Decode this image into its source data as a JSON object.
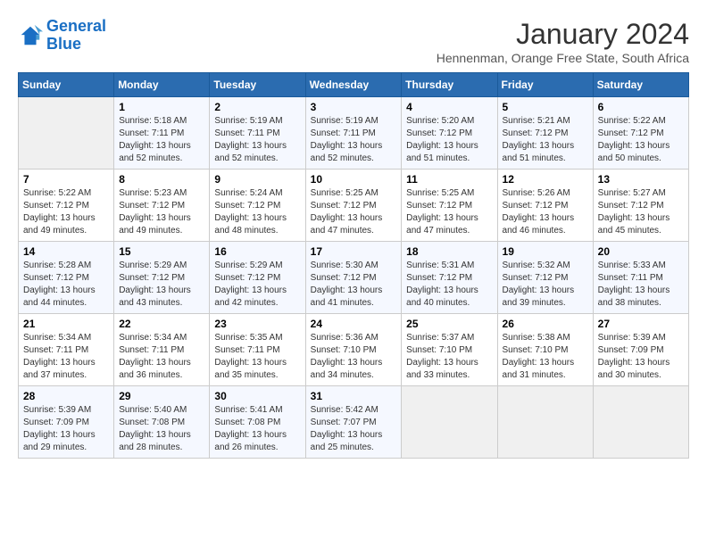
{
  "logo": {
    "line1": "General",
    "line2": "Blue"
  },
  "title": "January 2024",
  "location": "Hennenman, Orange Free State, South Africa",
  "weekdays": [
    "Sunday",
    "Monday",
    "Tuesday",
    "Wednesday",
    "Thursday",
    "Friday",
    "Saturday"
  ],
  "weeks": [
    [
      {
        "day": "",
        "sunrise": "",
        "sunset": "",
        "daylight": ""
      },
      {
        "day": "1",
        "sunrise": "Sunrise: 5:18 AM",
        "sunset": "Sunset: 7:11 PM",
        "daylight": "Daylight: 13 hours and 52 minutes."
      },
      {
        "day": "2",
        "sunrise": "Sunrise: 5:19 AM",
        "sunset": "Sunset: 7:11 PM",
        "daylight": "Daylight: 13 hours and 52 minutes."
      },
      {
        "day": "3",
        "sunrise": "Sunrise: 5:19 AM",
        "sunset": "Sunset: 7:11 PM",
        "daylight": "Daylight: 13 hours and 52 minutes."
      },
      {
        "day": "4",
        "sunrise": "Sunrise: 5:20 AM",
        "sunset": "Sunset: 7:12 PM",
        "daylight": "Daylight: 13 hours and 51 minutes."
      },
      {
        "day": "5",
        "sunrise": "Sunrise: 5:21 AM",
        "sunset": "Sunset: 7:12 PM",
        "daylight": "Daylight: 13 hours and 51 minutes."
      },
      {
        "day": "6",
        "sunrise": "Sunrise: 5:22 AM",
        "sunset": "Sunset: 7:12 PM",
        "daylight": "Daylight: 13 hours and 50 minutes."
      }
    ],
    [
      {
        "day": "7",
        "sunrise": "Sunrise: 5:22 AM",
        "sunset": "Sunset: 7:12 PM",
        "daylight": "Daylight: 13 hours and 49 minutes."
      },
      {
        "day": "8",
        "sunrise": "Sunrise: 5:23 AM",
        "sunset": "Sunset: 7:12 PM",
        "daylight": "Daylight: 13 hours and 49 minutes."
      },
      {
        "day": "9",
        "sunrise": "Sunrise: 5:24 AM",
        "sunset": "Sunset: 7:12 PM",
        "daylight": "Daylight: 13 hours and 48 minutes."
      },
      {
        "day": "10",
        "sunrise": "Sunrise: 5:25 AM",
        "sunset": "Sunset: 7:12 PM",
        "daylight": "Daylight: 13 hours and 47 minutes."
      },
      {
        "day": "11",
        "sunrise": "Sunrise: 5:25 AM",
        "sunset": "Sunset: 7:12 PM",
        "daylight": "Daylight: 13 hours and 47 minutes."
      },
      {
        "day": "12",
        "sunrise": "Sunrise: 5:26 AM",
        "sunset": "Sunset: 7:12 PM",
        "daylight": "Daylight: 13 hours and 46 minutes."
      },
      {
        "day": "13",
        "sunrise": "Sunrise: 5:27 AM",
        "sunset": "Sunset: 7:12 PM",
        "daylight": "Daylight: 13 hours and 45 minutes."
      }
    ],
    [
      {
        "day": "14",
        "sunrise": "Sunrise: 5:28 AM",
        "sunset": "Sunset: 7:12 PM",
        "daylight": "Daylight: 13 hours and 44 minutes."
      },
      {
        "day": "15",
        "sunrise": "Sunrise: 5:29 AM",
        "sunset": "Sunset: 7:12 PM",
        "daylight": "Daylight: 13 hours and 43 minutes."
      },
      {
        "day": "16",
        "sunrise": "Sunrise: 5:29 AM",
        "sunset": "Sunset: 7:12 PM",
        "daylight": "Daylight: 13 hours and 42 minutes."
      },
      {
        "day": "17",
        "sunrise": "Sunrise: 5:30 AM",
        "sunset": "Sunset: 7:12 PM",
        "daylight": "Daylight: 13 hours and 41 minutes."
      },
      {
        "day": "18",
        "sunrise": "Sunrise: 5:31 AM",
        "sunset": "Sunset: 7:12 PM",
        "daylight": "Daylight: 13 hours and 40 minutes."
      },
      {
        "day": "19",
        "sunrise": "Sunrise: 5:32 AM",
        "sunset": "Sunset: 7:12 PM",
        "daylight": "Daylight: 13 hours and 39 minutes."
      },
      {
        "day": "20",
        "sunrise": "Sunrise: 5:33 AM",
        "sunset": "Sunset: 7:11 PM",
        "daylight": "Daylight: 13 hours and 38 minutes."
      }
    ],
    [
      {
        "day": "21",
        "sunrise": "Sunrise: 5:34 AM",
        "sunset": "Sunset: 7:11 PM",
        "daylight": "Daylight: 13 hours and 37 minutes."
      },
      {
        "day": "22",
        "sunrise": "Sunrise: 5:34 AM",
        "sunset": "Sunset: 7:11 PM",
        "daylight": "Daylight: 13 hours and 36 minutes."
      },
      {
        "day": "23",
        "sunrise": "Sunrise: 5:35 AM",
        "sunset": "Sunset: 7:11 PM",
        "daylight": "Daylight: 13 hours and 35 minutes."
      },
      {
        "day": "24",
        "sunrise": "Sunrise: 5:36 AM",
        "sunset": "Sunset: 7:10 PM",
        "daylight": "Daylight: 13 hours and 34 minutes."
      },
      {
        "day": "25",
        "sunrise": "Sunrise: 5:37 AM",
        "sunset": "Sunset: 7:10 PM",
        "daylight": "Daylight: 13 hours and 33 minutes."
      },
      {
        "day": "26",
        "sunrise": "Sunrise: 5:38 AM",
        "sunset": "Sunset: 7:10 PM",
        "daylight": "Daylight: 13 hours and 31 minutes."
      },
      {
        "day": "27",
        "sunrise": "Sunrise: 5:39 AM",
        "sunset": "Sunset: 7:09 PM",
        "daylight": "Daylight: 13 hours and 30 minutes."
      }
    ],
    [
      {
        "day": "28",
        "sunrise": "Sunrise: 5:39 AM",
        "sunset": "Sunset: 7:09 PM",
        "daylight": "Daylight: 13 hours and 29 minutes."
      },
      {
        "day": "29",
        "sunrise": "Sunrise: 5:40 AM",
        "sunset": "Sunset: 7:08 PM",
        "daylight": "Daylight: 13 hours and 28 minutes."
      },
      {
        "day": "30",
        "sunrise": "Sunrise: 5:41 AM",
        "sunset": "Sunset: 7:08 PM",
        "daylight": "Daylight: 13 hours and 26 minutes."
      },
      {
        "day": "31",
        "sunrise": "Sunrise: 5:42 AM",
        "sunset": "Sunset: 7:07 PM",
        "daylight": "Daylight: 13 hours and 25 minutes."
      },
      {
        "day": "",
        "sunrise": "",
        "sunset": "",
        "daylight": ""
      },
      {
        "day": "",
        "sunrise": "",
        "sunset": "",
        "daylight": ""
      },
      {
        "day": "",
        "sunrise": "",
        "sunset": "",
        "daylight": ""
      }
    ]
  ]
}
